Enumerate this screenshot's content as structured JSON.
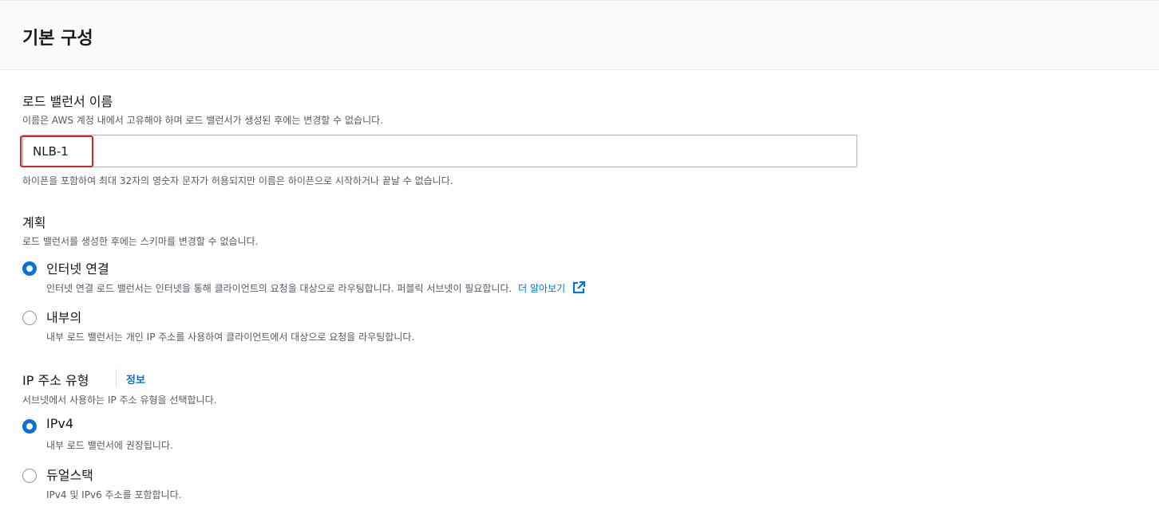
{
  "header": {
    "title": "기본 구성"
  },
  "lb_name": {
    "label": "로드 밸런서 이름",
    "description": "이름은 AWS 계정 내에서 고유해야 하며 로드 밸런서가 생성된 후에는 변경할 수 없습니다.",
    "value": "NLB-1",
    "hint": "하이픈을 포함하여 최대 32자의 영숫자 문자가 허용되지만 이름은 하이픈으로 시작하거나 끝날 수 없습니다."
  },
  "scheme": {
    "label": "계획",
    "description": "로드 밸런서를 생성한 후에는 스키마를 변경할 수 없습니다.",
    "options": [
      {
        "label": "인터넷 연결",
        "description": "인터넷 연결 로드 밸런서는 인터넷을 통해 클라이언트의 요청을 대상으로 라우팅합니다. 퍼블릭 서브넷이 필요합니다.",
        "link": "더 알아보기",
        "selected": true
      },
      {
        "label": "내부의",
        "description": "내부 로드 밸런서는 개인 IP 주소를 사용하여 클라이언트에서 대상으로 요청을 라우팅합니다.",
        "selected": false
      }
    ]
  },
  "ip_type": {
    "label": "IP 주소 유형",
    "info": "정보",
    "description": "서브넷에서 사용하는 IP 주소 유형을 선택합니다.",
    "options": [
      {
        "label": "IPv4",
        "description": "내부 로드 밸런서에 권장됩니다.",
        "selected": true
      },
      {
        "label": "듀얼스택",
        "description": "IPv4 및 IPv6 주소를 포함합니다.",
        "selected": false
      }
    ]
  },
  "colors": {
    "accent": "#0972d3",
    "highlight": "#e02020"
  }
}
